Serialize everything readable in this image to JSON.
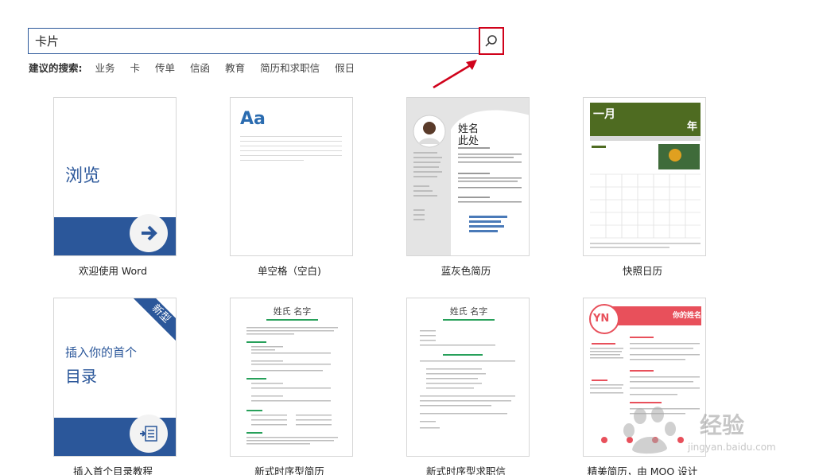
{
  "search": {
    "value": "卡片",
    "suggest_label": "建议的搜索:",
    "suggestions": [
      "业务",
      "卡",
      "传单",
      "信函",
      "教育",
      "简历和求职信",
      "假日"
    ]
  },
  "templates": [
    {
      "caption": "欢迎使用 Word",
      "thumb_text": "浏览"
    },
    {
      "caption": "单空格（空白)",
      "thumb_text": "Aa"
    },
    {
      "caption": "蓝灰色简历",
      "name_line1": "姓名",
      "name_line2": "此处"
    },
    {
      "caption": "快照日历",
      "month": "一月",
      "year": "年"
    },
    {
      "caption": "插入首个目录教程",
      "line1": "插入你的首个",
      "line2": "目录",
      "badge": "新型"
    },
    {
      "caption": "新式时序型简历",
      "heading": "姓氏 名字"
    },
    {
      "caption": "新式时序型求职信",
      "heading": "姓氏 名字"
    },
    {
      "caption": "精美简历，由 MOO 设计",
      "initials": "YN",
      "heading": "你的姓名"
    }
  ],
  "watermark": {
    "text": "经验",
    "sub": "jingyan.baidu.com"
  },
  "colors": {
    "accent": "#2b579a",
    "highlight": "#d0021b",
    "calendar": "#4e6b21"
  }
}
